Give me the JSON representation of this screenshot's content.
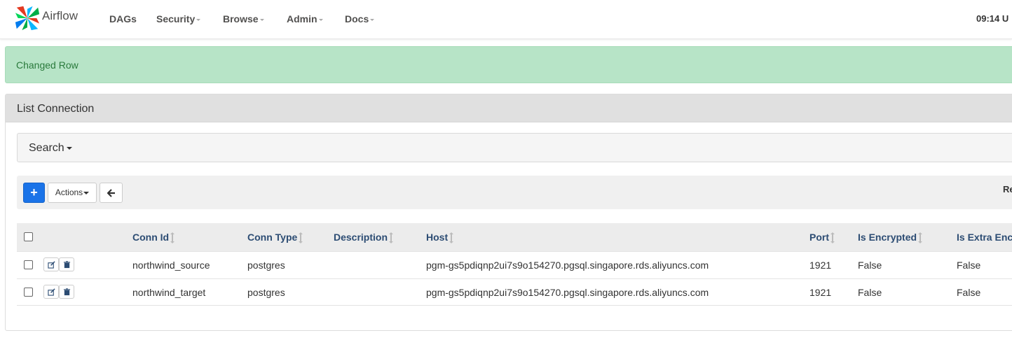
{
  "brand": {
    "name": "Airflow"
  },
  "nav": {
    "items": [
      {
        "label": "DAGs",
        "has_caret": false
      },
      {
        "label": "Security",
        "has_caret": true
      },
      {
        "label": "Browse",
        "has_caret": true
      },
      {
        "label": "Admin",
        "has_caret": true
      },
      {
        "label": "Docs",
        "has_caret": true
      }
    ],
    "clock": "09:14 U"
  },
  "alert": {
    "message": "Changed Row",
    "color": "#b7e4c7"
  },
  "panel": {
    "title": "List Connection"
  },
  "search": {
    "label": "Search"
  },
  "toolbar": {
    "add_label": "+",
    "actions_label": "Actions",
    "back_icon": "arrow-left-icon",
    "record_count_label": "Re"
  },
  "table": {
    "headers": {
      "conn_id": "Conn Id",
      "conn_type": "Conn Type",
      "description": "Description",
      "host": "Host",
      "port": "Port",
      "is_encrypted": "Is Encrypted",
      "is_extra_encrypted": "Is Extra Enc"
    },
    "rows": [
      {
        "conn_id": "northwind_source",
        "conn_type": "postgres",
        "description": "",
        "host": "pgm-gs5pdiqnp2ui7s9o154270.pgsql.singapore.rds.aliyuncs.com",
        "port": "1921",
        "is_encrypted": "False",
        "is_extra_encrypted": "False"
      },
      {
        "conn_id": "northwind_target",
        "conn_type": "postgres",
        "description": "",
        "host": "pgm-gs5pdiqnp2ui7s9o154270.pgsql.singapore.rds.aliyuncs.com",
        "port": "1921",
        "is_encrypted": "False",
        "is_extra_encrypted": "False"
      }
    ]
  },
  "colors": {
    "accent": "#1a73e8",
    "header_text": "#2c4c73",
    "alert_text": "#2a7a3c"
  }
}
